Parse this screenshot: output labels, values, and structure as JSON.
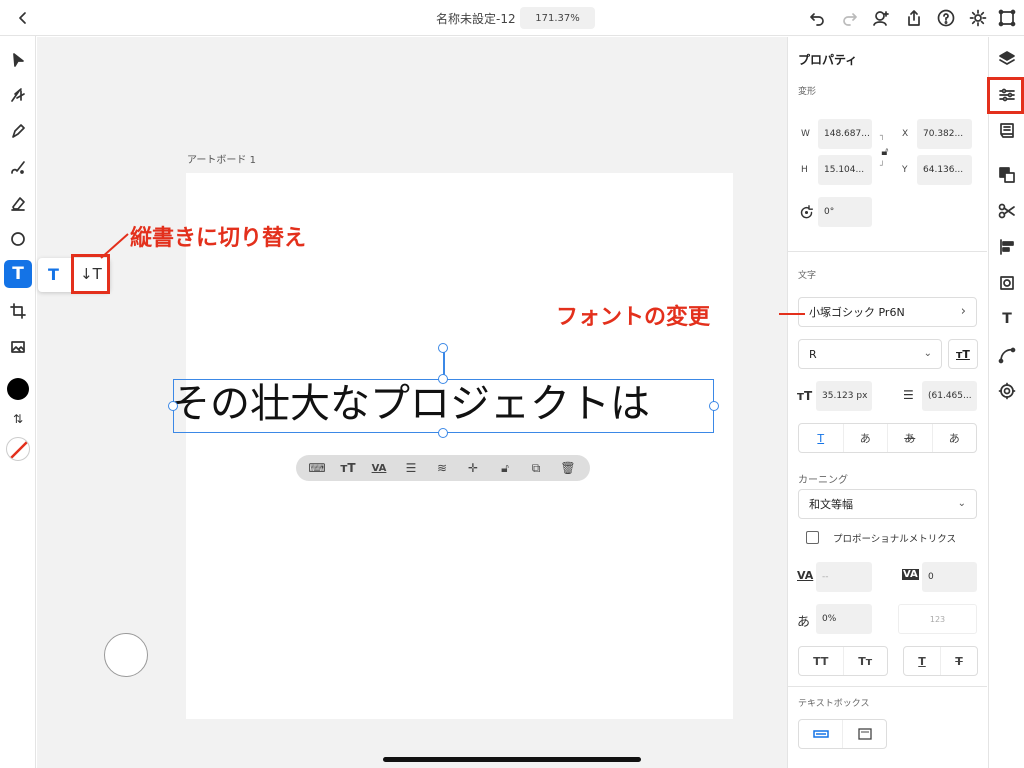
{
  "topbar": {
    "doc_title": "名称未設定-12",
    "zoom": "171.37%"
  },
  "canvas": {
    "artboard_label": "アートボード 1",
    "text": "その壮大なプロジェクトは"
  },
  "annotations": {
    "vertical": "縦書きに切り替え",
    "font": "フォントの変更"
  },
  "popover": {
    "horizontal": "T",
    "vertical": "↓T"
  },
  "panel": {
    "title": "プロパティ",
    "transform": {
      "section": "変形",
      "w_label": "W",
      "w": "148.687...",
      "h_label": "H",
      "h": "15.104...",
      "x_label": "X",
      "x": "70.382...",
      "y_label": "Y",
      "y": "64.136...",
      "rotation": "0°"
    },
    "text": {
      "section": "文字",
      "font": "小塚ゴシック Pr6N",
      "weight": "R",
      "size": "35.123 px",
      "leading": "(61.465...",
      "align": [
        "T",
        "あ",
        "あ",
        "あ"
      ],
      "kerning_label": "カーニング",
      "kerning": "和文等幅",
      "proportional": "プロポーショナルメトリクス",
      "tracking_empty": "--",
      "tracking": "0",
      "tsume": "0%",
      "tate_chu_yoko": "123",
      "caps": [
        "TT",
        "Tт"
      ],
      "decoration": [
        "T",
        "T"
      ]
    },
    "textbox_section": "テキストボックス"
  },
  "colors": {
    "accent": "#1473e6",
    "annotation": "#e3301c",
    "selection": "#3b88e6"
  }
}
